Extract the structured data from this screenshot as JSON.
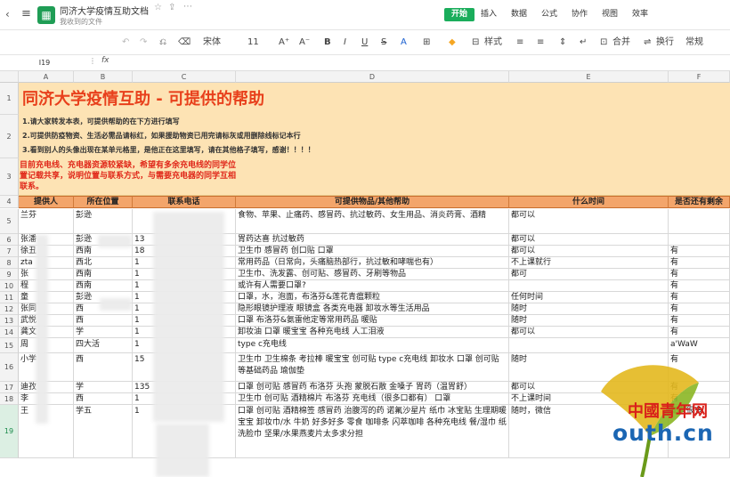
{
  "titlebar": {
    "doc_title": "同济大学疫情互助文档",
    "subtitle": "我收到的文件",
    "menu_tabs": [
      "开始",
      "插入",
      "数据",
      "公式",
      "协作",
      "视图",
      "效率"
    ]
  },
  "toolbar": {
    "undo": "↶",
    "redo": "↷",
    "paint": "⎌",
    "clear": "⌫",
    "font": "宋体",
    "size": "11",
    "grow": "A⁺",
    "shrink": "A⁻",
    "bold": "B",
    "italic": "I",
    "underline": "U",
    "strike": "S",
    "font_color": "A",
    "fill": "◆",
    "border": "⊞",
    "style_label": "样式",
    "align_left": "≡",
    "align_center": "≡",
    "align_v": "⇕",
    "wrap": "↵",
    "merge": "合并",
    "autowrap": "换行",
    "format": "常规"
  },
  "formula_bar": {
    "cell_ref": "I19",
    "fx": "fx",
    "value": ""
  },
  "columns": [
    "A",
    "B",
    "C",
    "D",
    "E",
    "F"
  ],
  "banner": {
    "title": "同济大学疫情互助 - 可提供的帮助",
    "note1": "1.请大家转发本表，可提供帮助的在下方进行填写",
    "note2": "2.可提供防疫物资、生活必需品请标红，如果援助物资已用完请标灰或用删除线标记本行",
    "note3": "3.看到别人的头像出现在某单元格里，是他正在这里填写，请在其他格子填写，感谢！！！！",
    "note_red": "目前充电线、充电器资源较紧缺，希望有多余充电线的同学位置记载共享，说明位置与联系方式，与需要充电器的同学互相联系。"
  },
  "headers": [
    "提供人",
    "所在位置",
    "联系电话",
    "可提供物品/其他帮助",
    "什么时间",
    "是否还有剩余"
  ],
  "rows": [
    {
      "n": "5",
      "a": "兰芬",
      "b": "彭逊",
      "c": "",
      "d": "食物、苹果、止痛药、感冒药、抗过敏药、女生用品、消炎药膏、酒精",
      "e": "都可以",
      "f": ""
    },
    {
      "n": "6",
      "a": "张潘",
      "b": "彭逊",
      "c": "13",
      "d": "胃药达喜 抗过敏药",
      "e": "都可以",
      "f": ""
    },
    {
      "n": "7",
      "a": "徐丑",
      "b": "西南",
      "c": "18",
      "d": "卫生巾 感冒药 创口贴 口罩",
      "e": "都可以",
      "f": "有"
    },
    {
      "n": "8",
      "a": "zta",
      "b": "西北",
      "c": "1",
      "d": "常用药品（日常向，头痛脑热部行，抗过敏和哮喘也有）",
      "e": "不上课就行",
      "f": "有"
    },
    {
      "n": "9",
      "a": "张",
      "b": "西南",
      "c": "1",
      "d": "卫生巾、洗发露、创可贴、感冒药、牙刷等物品",
      "e": "都可",
      "f": "有"
    },
    {
      "n": "10",
      "a": "程",
      "b": "西南",
      "c": "1",
      "d": "或许有人需要口罩?",
      "e": "",
      "f": "有"
    },
    {
      "n": "11",
      "a": "童",
      "b": "彭逊",
      "c": "1",
      "d": "口罩，水，泡面，布洛芬&莲花青瘟颗粒",
      "e": "任何时间",
      "f": "有"
    },
    {
      "n": "12",
      "a": "张同",
      "b": "西",
      "c": "1",
      "d": "隐形眼镜护理液 眼镜盒 各类充电器 卸妆水等生活用品",
      "e": "随时",
      "f": "有"
    },
    {
      "n": "13",
      "a": "武悦",
      "b": "西",
      "c": "1",
      "d": "口罩 布洛芬&氨雷他定等常用药品 暖贴",
      "e": "随时",
      "f": "有"
    },
    {
      "n": "14",
      "a": "龚文",
      "b": "学",
      "c": "1",
      "d": "卸妆油 口罩 暖宝宝 各种充电线 人工泪液",
      "e": "都可以",
      "f": "有"
    },
    {
      "n": "15",
      "a": "周",
      "b": "四大活",
      "c": "1",
      "d": "type c充电线",
      "e": "",
      "f": "a'WaW"
    },
    {
      "n": "16",
      "a": "小学",
      "b": "西",
      "c": "15",
      "d": "卫生巾 卫生棉条 考拉棒 暖宝宝 创可贴 type c充电线 卸妆水 口罩 创可贴等基础药品 瑜伽垫",
      "e": "随时",
      "f": "有"
    },
    {
      "n": "17",
      "a": "迪孜",
      "b": "学",
      "c": "135",
      "d": "口罩 创可贴 感冒药 布洛芬 头孢 蒙脱石散 金嗓子 胃药（温胃舒）",
      "e": "都可以",
      "f": "有"
    },
    {
      "n": "18",
      "a": "李",
      "b": "西",
      "c": "1",
      "d": "卫生巾 创可贴 酒精棉片 布洛芬 充电线（很多口都有） 口罩",
      "e": "不上课时间",
      "f": "有"
    },
    {
      "n": "19",
      "a": "王",
      "b": "学五",
      "c": "1",
      "d": "口罩 创可贴 酒精棉签 感冒药 治腹泻的药 诺氟沙星片 纸巾 冰宝贴 生理期暖宝宝 卸妆巾/水 牛奶 好多好多 零食 咖啡条 闪萃咖啡 各种充电线 餐/湿巾 纸洗脸巾 坚果/水果燕麦片太多求分担",
      "e": "随时，微信",
      "f": "都有很多"
    }
  ],
  "watermark": {
    "cn": "中國青年网",
    "en": "outh.cn"
  }
}
